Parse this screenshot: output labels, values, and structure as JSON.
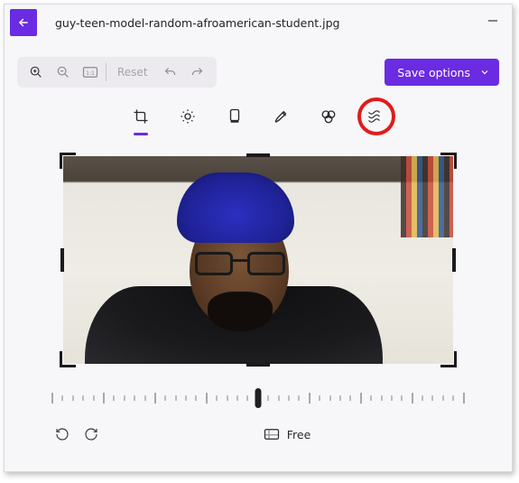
{
  "titlebar": {
    "filename": "guy-teen-model-random-afroamerican-student.jpg"
  },
  "toolbar": {
    "reset_label": "Reset",
    "save_options_label": "Save options"
  },
  "tools": {
    "crop": "crop",
    "adjust": "adjust",
    "filter": "filter",
    "markup": "markup",
    "retouch": "retouch",
    "background": "background"
  },
  "ruler": {
    "value": 0
  },
  "bottom": {
    "aspect_label": "Free"
  },
  "colors": {
    "accent": "#6a2be2",
    "highlight": "#e01c1c"
  }
}
